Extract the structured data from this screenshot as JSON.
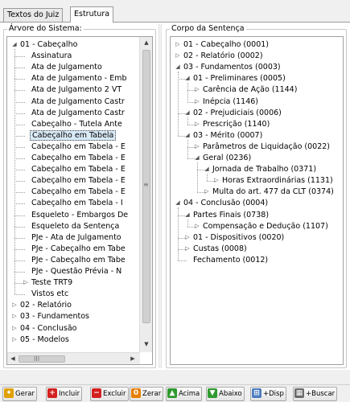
{
  "tabs": [
    {
      "label": "Textos do Juiz",
      "active": false
    },
    {
      "label": "Estrutura",
      "active": true
    }
  ],
  "left_panel": {
    "title": "Árvore do Sistema:",
    "nodes": [
      {
        "label": "01 - Cabeçalho",
        "toggle": "expanded"
      },
      {
        "label": "Assinatura",
        "toggle": "none"
      },
      {
        "label": "Ata de Julgamento",
        "toggle": "none"
      },
      {
        "label": "Ata de Julgamento - Emb",
        "toggle": "none"
      },
      {
        "label": "Ata de Julgamento 2 VT",
        "toggle": "none"
      },
      {
        "label": "Ata de Julgamento Castr",
        "toggle": "none"
      },
      {
        "label": "Ata de Julgamento Castr",
        "toggle": "none"
      },
      {
        "label": "Cabeçalho - Tutela Ante",
        "toggle": "none"
      },
      {
        "label": "Cabeçalho em Tabela",
        "toggle": "none",
        "selected": true
      },
      {
        "label": "Cabeçalho em Tabela - E",
        "toggle": "none"
      },
      {
        "label": "Cabeçalho em Tabela - E",
        "toggle": "none"
      },
      {
        "label": "Cabeçalho em Tabela - E",
        "toggle": "none"
      },
      {
        "label": "Cabeçalho em Tabela - E",
        "toggle": "none"
      },
      {
        "label": "Cabeçalho em Tabela - E",
        "toggle": "none"
      },
      {
        "label": "Cabeçalho em Tabela - I",
        "toggle": "none"
      },
      {
        "label": "Esqueleto - Embargos De",
        "toggle": "none"
      },
      {
        "label": "Esqueleto da Sentença",
        "toggle": "none"
      },
      {
        "label": "PJe - Ata de Julgamento",
        "toggle": "none"
      },
      {
        "label": "PJe - Cabeçalho em Tabe",
        "toggle": "none"
      },
      {
        "label": "PJe - Cabeçalho em Tabe",
        "toggle": "none"
      },
      {
        "label": "PJe - Questão Prévia - N",
        "toggle": "none"
      },
      {
        "label": "Teste TRT9",
        "toggle": "collapsed"
      },
      {
        "label": "Vistos etc",
        "toggle": "none"
      },
      {
        "label": "02 - Relatório",
        "toggle": "collapsed"
      },
      {
        "label": "03 - Fundamentos",
        "toggle": "collapsed"
      },
      {
        "label": "04 - Conclusão",
        "toggle": "collapsed"
      },
      {
        "label": "05 - Modelos",
        "toggle": "collapsed"
      }
    ],
    "hscroll_grip": "III"
  },
  "right_panel": {
    "title": "Corpo da Sentença",
    "nodes": [
      {
        "label": "01 - Cabeçalho (0001)",
        "toggle": "collapsed"
      },
      {
        "label": "02 - Relatório (0002)",
        "toggle": "collapsed"
      },
      {
        "label": "03 - Fundamentos (0003)",
        "toggle": "expanded"
      },
      {
        "label": "01 - Preliminares (0005)",
        "toggle": "expanded"
      },
      {
        "label": "Carência de Ação (1144)",
        "toggle": "collapsed"
      },
      {
        "label": "Inépcia (1146)",
        "toggle": "collapsed"
      },
      {
        "label": "02 - Prejudiciais (0006)",
        "toggle": "expanded"
      },
      {
        "label": "Prescrição (1140)",
        "toggle": "collapsed"
      },
      {
        "label": "03 - Mérito (0007)",
        "toggle": "expanded"
      },
      {
        "label": "Parâmetros de Liquidação (0022)",
        "toggle": "collapsed"
      },
      {
        "label": "Geral (0236)",
        "toggle": "expanded"
      },
      {
        "label": "Jornada de Trabalho (0371)",
        "toggle": "expanded"
      },
      {
        "label": "Horas Extraordinárias (1131)",
        "toggle": "collapsed"
      },
      {
        "label": "Multa do art. 477 da CLT (0374)",
        "toggle": "collapsed"
      },
      {
        "label": "04 - Conclusão (0004)",
        "toggle": "expanded"
      },
      {
        "label": "Partes Finais (0738)",
        "toggle": "expanded"
      },
      {
        "label": "Compensação e Dedução (1107)",
        "toggle": "collapsed"
      },
      {
        "label": "01 - Dispositivos (0020)",
        "toggle": "collapsed"
      },
      {
        "label": "Custas (0008)",
        "toggle": "collapsed"
      },
      {
        "label": "Fechamento (0012)",
        "toggle": "none"
      }
    ]
  },
  "toolbar": {
    "buttons": [
      {
        "label": "Gerar",
        "icon": "wand-icon",
        "color": "#e0a000"
      },
      {
        "label": "Incluir",
        "icon": "plus-icon",
        "color": "#d42020"
      },
      {
        "label": "Excluir",
        "icon": "minus-icon",
        "color": "#d42020"
      },
      {
        "label": "Zerar",
        "icon": "zero-icon",
        "color": "#e88000"
      },
      {
        "label": "Acima",
        "icon": "arrow-up-icon",
        "color": "#2f9a2f"
      },
      {
        "label": "Abaixo",
        "icon": "arrow-down-icon",
        "color": "#2f9a2f"
      },
      {
        "label": "+Disp",
        "icon": "tree-add-icon",
        "color": "#4a7cc0"
      },
      {
        "label": "+Buscar",
        "icon": "table-icon",
        "color": "#6a6a6a"
      }
    ]
  }
}
